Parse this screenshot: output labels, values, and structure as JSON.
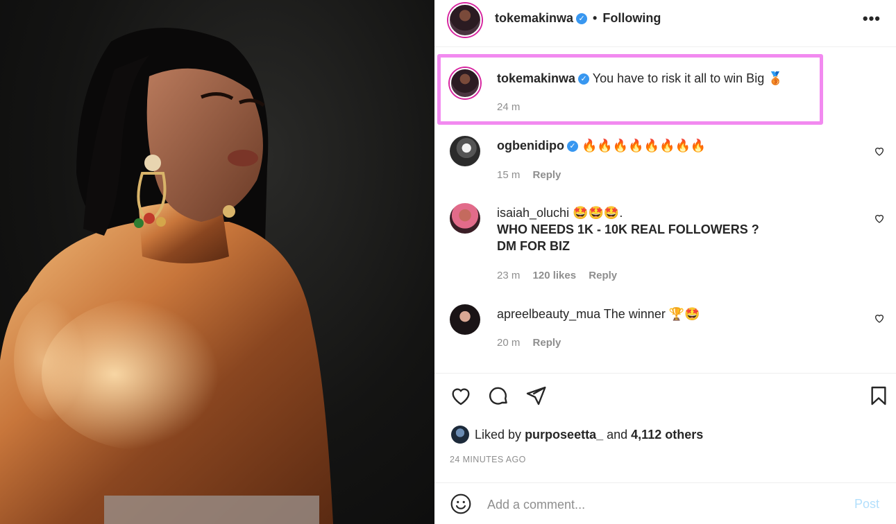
{
  "photo": {
    "description_icon": "post-photo"
  },
  "header": {
    "username": "tokemakinwa",
    "separator": "•",
    "follow_status": "Following",
    "more_icon": "more-icon"
  },
  "caption": {
    "username": "tokemakinwa",
    "text": "You have to risk it all to win Big 🥉",
    "time": "24 m"
  },
  "comments": [
    {
      "username": "ogbenidipo",
      "verified": true,
      "text": "🔥🔥🔥🔥🔥🔥🔥🔥",
      "time": "15 m",
      "reply": "Reply"
    },
    {
      "username": "isaiah_oluchi",
      "verified": false,
      "text_line1": "🤩🤩🤩.",
      "text_line2": "WHO NEEDS 1K - 10K REAL FOLLOWERS ?",
      "text_line3": "DM FOR BIZ",
      "time": "23 m",
      "likes": "120 likes",
      "reply": "Reply"
    },
    {
      "username": "apreelbeauty_mua",
      "verified": false,
      "text": "The winner 🏆🤩",
      "time": "20 m",
      "reply": "Reply"
    }
  ],
  "likes": {
    "prefix": "Liked by",
    "user": "purposeetta_",
    "and": "and",
    "others": "4,112 others"
  },
  "time_ago": "24 MINUTES AGO",
  "add_comment": {
    "placeholder": "Add a comment...",
    "post_label": "Post"
  },
  "colors": {
    "highlight": "#f28af0",
    "verified": "#3897f0",
    "post_disabled": "#b2dffc"
  }
}
